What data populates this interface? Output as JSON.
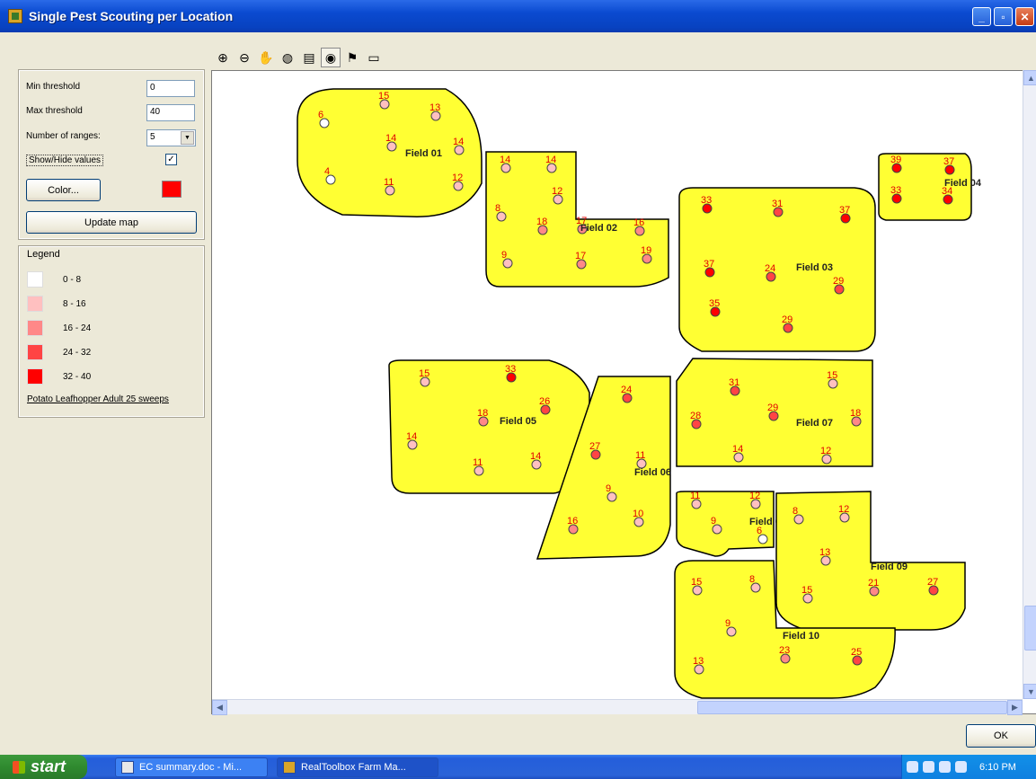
{
  "window": {
    "title": "Single Pest Scouting per Location",
    "min": "_",
    "max": "▫",
    "close": "✕"
  },
  "settings": {
    "min_threshold_label": "Min threshold",
    "min_threshold_value": "0",
    "max_threshold_label": "Max threshold",
    "max_threshold_value": "40",
    "ranges_label": "Number of ranges:",
    "ranges_value": "5",
    "show_hide_label": "Show/Hide values",
    "show_hide_checked": "✓",
    "color_button": "Color...",
    "color_value": "#ff0000",
    "update_button": "Update map"
  },
  "legend": {
    "title": "Legend",
    "entries": [
      {
        "label": "0 - 8",
        "color": "#ffffff"
      },
      {
        "label": "8 - 16",
        "color": "#ffc0c0"
      },
      {
        "label": "16 - 24",
        "color": "#ff8888"
      },
      {
        "label": "24 - 32",
        "color": "#ff4444"
      },
      {
        "label": "32 - 40",
        "color": "#ff0000"
      }
    ],
    "caption": "Potato Leafhopper Adult 25 sweeps"
  },
  "toolbar": {
    "icons": [
      "zoom-in-icon",
      "zoom-out-icon",
      "pan-hand-icon",
      "globe-icon",
      "print-icon",
      "identify-icon",
      "flag-icon",
      "ruler-icon"
    ]
  },
  "map": {
    "fields": [
      {
        "name": "Field 01",
        "points": [
          [
            6,
            0.5
          ],
          [
            15,
            0
          ],
          [
            13,
            1
          ],
          [
            14,
            0
          ],
          [
            14,
            1
          ],
          [
            4,
            0.5
          ],
          [
            11,
            0
          ],
          [
            12,
            1
          ]
        ]
      },
      {
        "name": "Field 02",
        "points": [
          [
            14,
            0
          ],
          [
            14,
            0
          ],
          [
            12,
            0
          ],
          [
            8,
            0
          ],
          [
            18,
            1
          ],
          [
            17,
            0
          ],
          [
            16,
            1
          ],
          [
            9,
            0
          ],
          [
            17,
            1
          ],
          [
            19,
            1
          ]
        ]
      },
      {
        "name": "Field 03",
        "points": [
          [
            33,
            1
          ],
          [
            31,
            1
          ],
          [
            37,
            1
          ],
          [
            37,
            1
          ],
          [
            24,
            1
          ],
          [
            29,
            1
          ],
          [
            35,
            1
          ],
          [
            29,
            1
          ]
        ]
      },
      {
        "name": "Field 04",
        "points": [
          [
            39,
            1
          ],
          [
            37,
            1
          ],
          [
            33,
            1
          ],
          [
            34,
            1
          ]
        ]
      },
      {
        "name": "Field 05",
        "points": [
          [
            15,
            0
          ],
          [
            33,
            1
          ],
          [
            26,
            1
          ],
          [
            18,
            0
          ],
          [
            14,
            0
          ],
          [
            11,
            0
          ],
          [
            14,
            0
          ]
        ]
      },
      {
        "name": "Field 06",
        "points": [
          [
            24,
            1
          ],
          [
            27,
            1
          ],
          [
            11,
            0
          ],
          [
            9,
            0
          ],
          [
            16,
            0
          ],
          [
            10,
            0
          ]
        ]
      },
      {
        "name": "Field 07",
        "points": [
          [
            31,
            1
          ],
          [
            29,
            1
          ],
          [
            15,
            0
          ],
          [
            28,
            1
          ],
          [
            18,
            0
          ],
          [
            14,
            0
          ],
          [
            12,
            0
          ]
        ]
      },
      {
        "name": "Field 08",
        "points": [
          [
            11,
            0
          ],
          [
            12,
            0
          ],
          [
            9,
            0
          ],
          [
            6,
            0.5
          ]
        ]
      },
      {
        "name": "Field 09",
        "points": [
          [
            8,
            0
          ],
          [
            12,
            0
          ],
          [
            13,
            0
          ],
          [
            21,
            1
          ],
          [
            27,
            1
          ],
          [
            15,
            0
          ]
        ]
      },
      {
        "name": "Field 10",
        "points": [
          [
            15,
            0
          ],
          [
            8,
            0
          ],
          [
            9,
            0
          ],
          [
            23,
            1
          ],
          [
            25,
            1
          ],
          [
            13,
            0
          ]
        ]
      }
    ]
  },
  "buttons": {
    "ok": "OK"
  },
  "taskbar": {
    "start": "start",
    "tasks": [
      "EC summary.doc - Mi...",
      "RealToolbox Farm Ma..."
    ],
    "clock": "6:10 PM"
  }
}
